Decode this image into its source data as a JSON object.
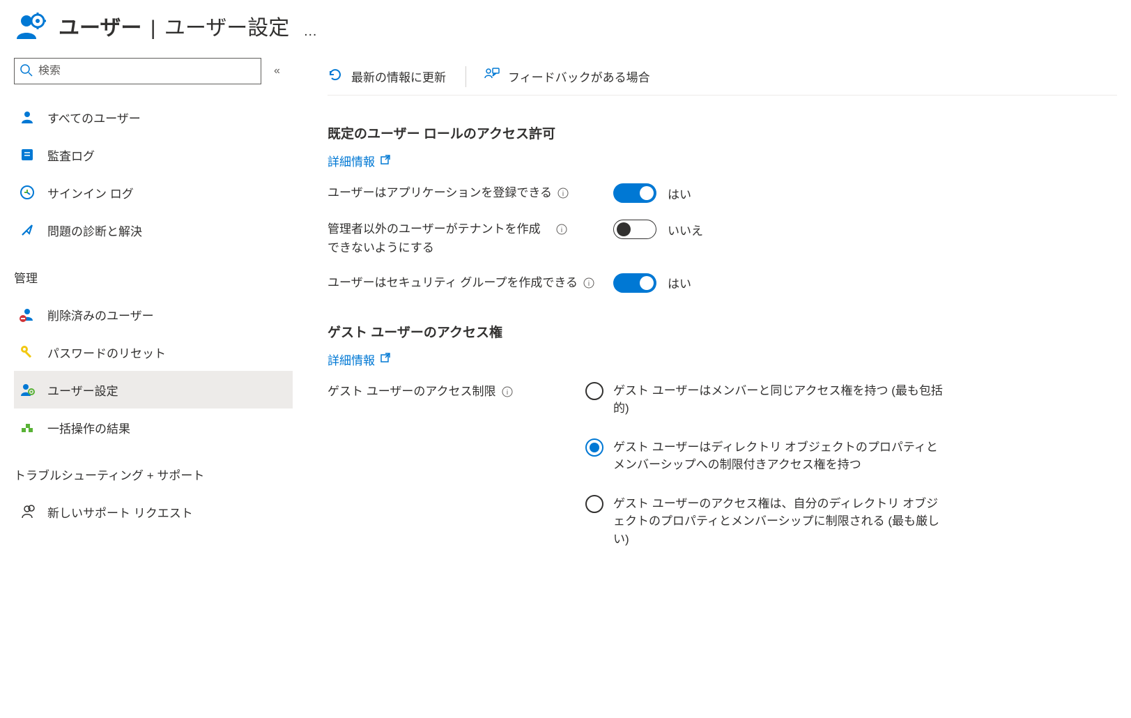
{
  "header": {
    "title_main": "ユーザー",
    "title_sep": "|",
    "title_sub": "ユーザー設定",
    "more": "…"
  },
  "sidebar": {
    "search_placeholder": "検索",
    "items_top": [
      {
        "label": "すべてのユーザー",
        "icon": "user",
        "selected": false
      },
      {
        "label": "監査ログ",
        "icon": "log",
        "selected": false
      },
      {
        "label": "サインイン ログ",
        "icon": "signin",
        "selected": false
      },
      {
        "label": "問題の診断と解決",
        "icon": "diagnose",
        "selected": false
      }
    ],
    "group_manage": "管理",
    "items_manage": [
      {
        "label": "削除済みのユーザー",
        "icon": "deleted-user",
        "selected": false
      },
      {
        "label": "パスワードのリセット",
        "icon": "key",
        "selected": false
      },
      {
        "label": "ユーザー設定",
        "icon": "user-settings",
        "selected": true
      },
      {
        "label": "一括操作の結果",
        "icon": "bulk",
        "selected": false
      }
    ],
    "group_support": "トラブルシューティング + サポート",
    "items_support": [
      {
        "label": "新しいサポート リクエスト",
        "icon": "support",
        "selected": false
      }
    ]
  },
  "toolbar": {
    "refresh": "最新の情報に更新",
    "feedback": "フィードバックがある場合"
  },
  "main": {
    "section1_title": "既定のユーザー ロールのアクセス許可",
    "learn_more": "詳細情報",
    "setting1_label": "ユーザーはアプリケーションを登録できる",
    "setting2_label": "管理者以外のユーザーがテナントを作成できないようにする",
    "setting3_label": "ユーザーはセキュリティ グループを作成できる",
    "yes": "はい",
    "no": "いいえ",
    "section2_title": "ゲスト ユーザーのアクセス権",
    "guest_label": "ゲスト ユーザーのアクセス制限",
    "radio1": "ゲスト ユーザーはメンバーと同じアクセス権を持つ (最も包括的)",
    "radio2": "ゲスト ユーザーはディレクトリ オブジェクトのプロパティとメンバーシップへの制限付きアクセス権を持つ",
    "radio3": "ゲスト ユーザーのアクセス権は、自分のディレクトリ オブジェクトのプロパティとメンバーシップに制限される (最も厳しい)"
  }
}
